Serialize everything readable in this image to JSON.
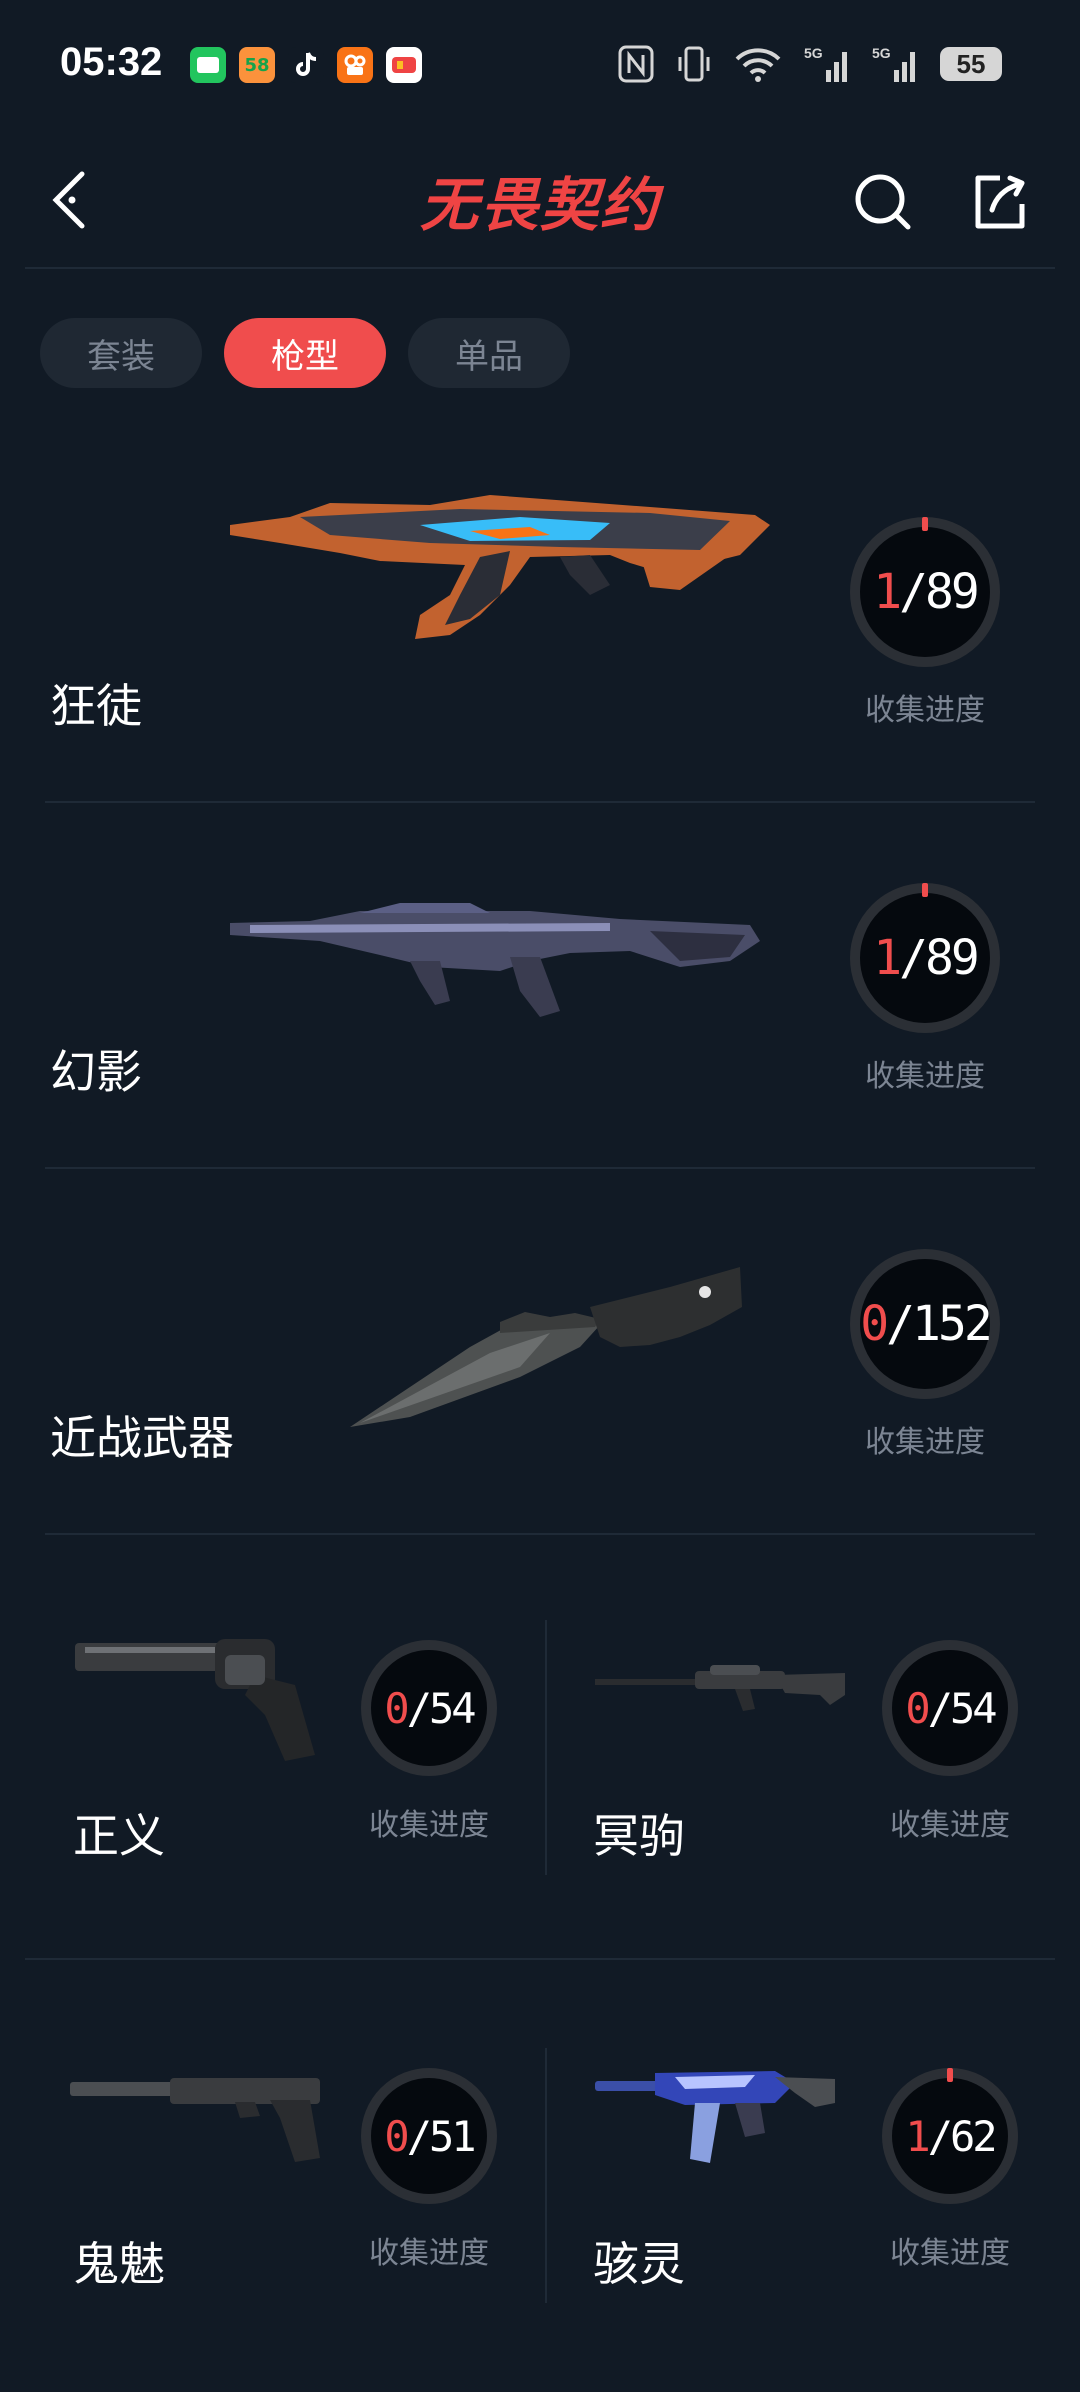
{
  "status_bar": {
    "time": "05:32",
    "battery": "55",
    "notifications": [
      {
        "name": "messages-app-icon",
        "color": "#22c55e",
        "glyph": "▬"
      },
      {
        "name": "58-app-icon",
        "color": "#f97316",
        "glyph": "58"
      },
      {
        "name": "tiktok-app-icon",
        "color": "#000000",
        "glyph": "♪"
      },
      {
        "name": "kuaishou-app-icon",
        "color": "#f97316",
        "glyph": "◎"
      },
      {
        "name": "game-app-icon",
        "color": "#ef4444",
        "glyph": "◆"
      }
    ]
  },
  "header": {
    "title": "无畏契约"
  },
  "tabs": [
    {
      "label": "套装",
      "active": false
    },
    {
      "label": "枪型",
      "active": true
    },
    {
      "label": "单品",
      "active": false
    }
  ],
  "progress_label": "收集进度",
  "big_items": [
    {
      "name": "狂徒",
      "owned": "1",
      "total": "/89",
      "progress": 0.011
    },
    {
      "name": "幻影",
      "owned": "1",
      "total": "/89",
      "progress": 0.011
    },
    {
      "name": "近战武器",
      "owned": "0",
      "total": "/152",
      "progress": 0
    }
  ],
  "grid_items": [
    {
      "name": "正义",
      "owned": "0",
      "total": "/54",
      "progress": 0
    },
    {
      "name": "冥驹",
      "owned": "0",
      "total": "/54",
      "progress": 0
    },
    {
      "name": "鬼魅",
      "owned": "0",
      "total": "/51",
      "progress": 0
    },
    {
      "name": "骇灵",
      "owned": "1",
      "total": "/62",
      "progress": 0.016
    }
  ],
  "colors": {
    "background": "#111a25",
    "accent": "#f04d4d",
    "muted_text": "#7c8593"
  }
}
